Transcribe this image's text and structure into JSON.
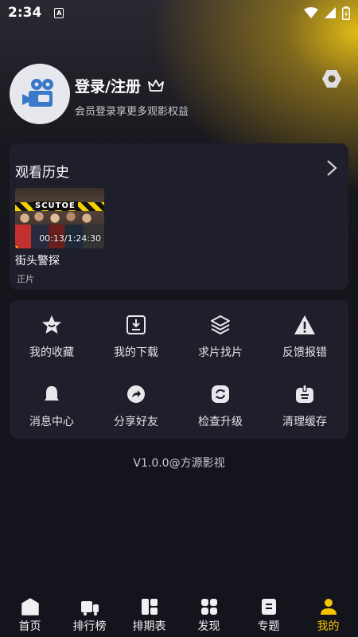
{
  "status_bar": {
    "time": "2:34",
    "notification_letter": "A"
  },
  "profile": {
    "title": "登录/注册",
    "subtitle": "会员登录享更多观影权益"
  },
  "history": {
    "title": "观看历史",
    "items": [
      {
        "title": "街头警探",
        "type": "正片",
        "progress_text": "00:13/1:24:30",
        "progress_fraction": 0.003,
        "poster_text": "SCUTOE"
      }
    ]
  },
  "menu": {
    "items": [
      {
        "label": "我的收藏",
        "icon": "star-icon"
      },
      {
        "label": "我的下载",
        "icon": "download-icon"
      },
      {
        "label": "求片找片",
        "icon": "layers-icon"
      },
      {
        "label": "反馈报错",
        "icon": "warning-icon"
      },
      {
        "label": "消息中心",
        "icon": "bell-icon"
      },
      {
        "label": "分享好友",
        "icon": "share-icon"
      },
      {
        "label": "检查升级",
        "icon": "refresh-icon"
      },
      {
        "label": "清理缓存",
        "icon": "broom-icon"
      }
    ]
  },
  "version": "V1.0.0@方源影视",
  "tabbar": {
    "tabs": [
      {
        "label": "首页",
        "icon": "home-icon"
      },
      {
        "label": "排行榜",
        "icon": "ranking-icon"
      },
      {
        "label": "排期表",
        "icon": "schedule-icon"
      },
      {
        "label": "发现",
        "icon": "discover-icon"
      },
      {
        "label": "专题",
        "icon": "topic-icon"
      },
      {
        "label": "我的",
        "icon": "user-icon",
        "active": true
      }
    ]
  },
  "colors": {
    "accent": "#f4c400",
    "card": "#1f1f2b",
    "background": "#14141c"
  }
}
